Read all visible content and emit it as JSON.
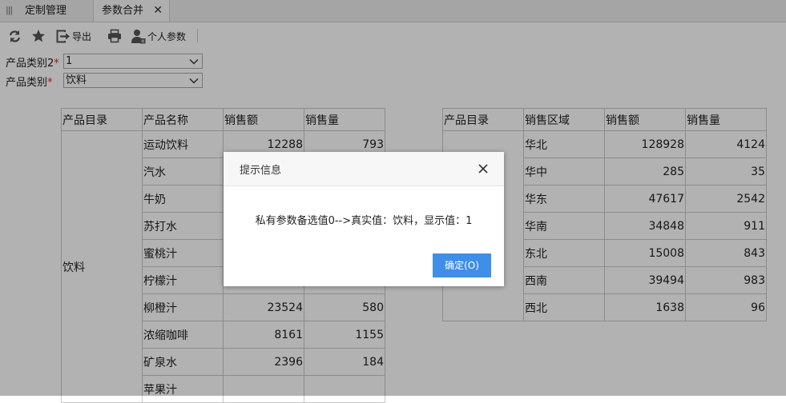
{
  "tabs": [
    {
      "label": "定制管理",
      "active": false
    },
    {
      "label": "参数合并",
      "active": true
    }
  ],
  "tab_close_glyph": "✕",
  "toolbar": {
    "items": [
      {
        "icon": "refresh-icon"
      },
      {
        "icon": "star-icon"
      },
      {
        "icon": "export-icon",
        "label": "导出"
      },
      {
        "icon": "print-icon"
      },
      {
        "icon": "user-params-icon",
        "label": "个人参数"
      }
    ]
  },
  "params": [
    {
      "label": "产品类别2",
      "required": "*",
      "value": "1"
    },
    {
      "label": "产品类别",
      "required": "*",
      "value": "饮料"
    }
  ],
  "table_left": {
    "headers": [
      "产品目录",
      "产品名称",
      "销售额",
      "销售量"
    ],
    "group": "饮料",
    "rows": [
      [
        "运动饮料",
        "12288",
        "793"
      ],
      [
        "汽水",
        "",
        ""
      ],
      [
        "牛奶",
        "",
        ""
      ],
      [
        "苏打水",
        "",
        ""
      ],
      [
        "蜜桃汁",
        "",
        ""
      ],
      [
        "柠檬汁",
        "",
        ""
      ],
      [
        "柳橙汁",
        "23524",
        "580"
      ],
      [
        "浓缩咖啡",
        "8161",
        "1155"
      ],
      [
        "矿泉水",
        "2396",
        "184"
      ],
      [
        "苹果汁",
        "",
        ""
      ]
    ]
  },
  "table_right": {
    "headers": [
      "产品目录",
      "销售区域",
      "销售额",
      "销售量"
    ],
    "rows": [
      [
        "华北",
        "128928",
        "4124"
      ],
      [
        "华中",
        "285",
        "35"
      ],
      [
        "华东",
        "47617",
        "2542"
      ],
      [
        "华南",
        "34848",
        "911"
      ],
      [
        "东北",
        "15008",
        "843"
      ],
      [
        "西南",
        "39494",
        "983"
      ],
      [
        "西北",
        "1638",
        "96"
      ]
    ]
  },
  "dialog": {
    "title": "提示信息",
    "message": "私有参数备选值0-->真实值：饮料，显示值：1",
    "ok_label": "确定(O)"
  },
  "colors": {
    "primary_button": "#3f8ee8",
    "required_mark": "#e02020",
    "overlay": "rgba(0,0,0,0.30)"
  }
}
